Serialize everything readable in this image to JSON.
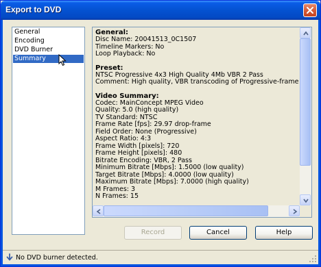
{
  "window": {
    "title": "Export to DVD",
    "close_icon": "close-x-icon"
  },
  "nav": {
    "items": [
      {
        "label": "General",
        "selected": false
      },
      {
        "label": "Encoding",
        "selected": false
      },
      {
        "label": "DVD Burner",
        "selected": false
      },
      {
        "label": "Summary",
        "selected": true
      }
    ]
  },
  "summary": {
    "general": {
      "title": "General:",
      "lines": [
        "Disc Name: 20041513_0C1507",
        "Timeline Markers: No",
        "Loop Playback: No"
      ]
    },
    "preset": {
      "title": "Preset:",
      "lines": [
        "NTSC Progressive 4x3 High Quality 4Mb VBR 2 Pass",
        "Comment: High quality, VBR transcoding of Progressive-frame content (ma:"
      ]
    },
    "video": {
      "title": "Video Summary:",
      "lines": [
        "Codec: MainConcept MPEG Video",
        "Quality: 5.0 (high quality)",
        "TV Standard: NTSC",
        "Frame Rate [fps]: 29.97 drop-frame",
        "Field Order: None (Progressive)",
        "Aspect Ratio: 4:3",
        "Frame Width [pixels]: 720",
        "Frame Height [pixels]: 480",
        "Bitrate Encoding: VBR, 2 Pass",
        "Minimum Bitrate [Mbps]: 1.5000 (low quality)",
        "Target Bitrate [Mbps]: 4.0000 (low quality)",
        "Maximum Bitrate [Mbps]: 7.0000 (high quality)",
        "M Frames: 3",
        "N Frames: 15"
      ]
    }
  },
  "buttons": {
    "record": "Record",
    "cancel": "Cancel",
    "help": "Help"
  },
  "status": {
    "text": "No DVD burner detected.",
    "icon": "arrow-down-icon"
  }
}
